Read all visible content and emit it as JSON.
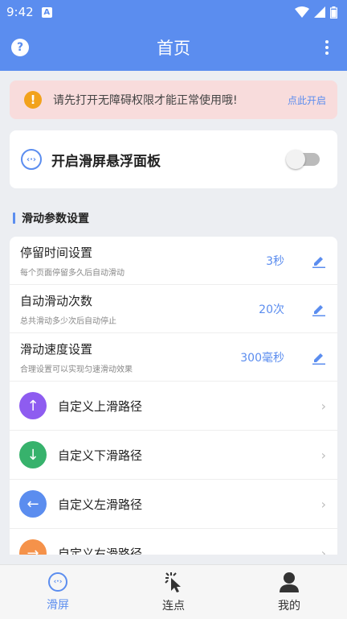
{
  "status_bar": {
    "time": "9:42",
    "notification_badge": "A"
  },
  "app_bar": {
    "title": "首页",
    "help_symbol": "?"
  },
  "alert": {
    "symbol": "!",
    "message": "请先打开无障碍权限才能正常使用哦!",
    "link": "点此开启",
    "color": "#f8dcdc"
  },
  "float_panel": {
    "label": "开启滑屏悬浮面板",
    "icon_glyph": "‹·›",
    "enabled": false
  },
  "section": {
    "title": "滑动参数设置"
  },
  "settings": [
    {
      "title": "停留时间设置",
      "subtitle": "每个页面停留多久后自动滑动",
      "value": "3秒"
    },
    {
      "title": "自动滑动次数",
      "subtitle": "总共滑动多少次后自动停止",
      "value": "20次"
    },
    {
      "title": "滑动速度设置",
      "subtitle": "合理设置可以实现匀速滑动效果",
      "value": "300毫秒"
    }
  ],
  "paths": [
    {
      "label": "自定义上滑路径",
      "arrow": "↑",
      "color": "#8e5cf0",
      "icon": "arrow-up-icon"
    },
    {
      "label": "自定义下滑路径",
      "arrow": "↓",
      "color": "#37b26c",
      "icon": "arrow-down-icon"
    },
    {
      "label": "自定义左滑路径",
      "arrow": "←",
      "color": "#5b8def",
      "icon": "arrow-left-icon"
    },
    {
      "label": "自定义右滑路径",
      "arrow": "→",
      "color": "#f5924a",
      "icon": "arrow-right-icon"
    }
  ],
  "bottom_nav": [
    {
      "label": "滑屏",
      "icon": "swipe-icon",
      "active": true
    },
    {
      "label": "连点",
      "icon": "tap-icon",
      "active": false
    },
    {
      "label": "我的",
      "icon": "profile-icon",
      "active": false
    }
  ],
  "colors": {
    "primary": "#5b8def",
    "accent_text": "#5b8def"
  }
}
